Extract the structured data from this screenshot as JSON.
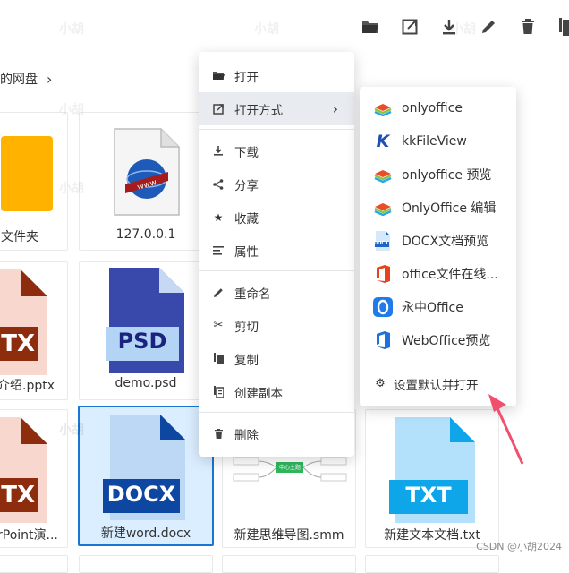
{
  "toolbar": {
    "icons": [
      "folder-open-icon",
      "open-external-icon",
      "download-icon",
      "edit-icon",
      "delete-icon",
      "copy-icon"
    ]
  },
  "breadcrumb": {
    "current": "的网盘",
    "separator": "›"
  },
  "files": [
    {
      "name": "文件夹",
      "type": "folder"
    },
    {
      "name": "127.0.0.1",
      "type": "web"
    },
    {
      "name": "介绍.pptx",
      "type": "pptx",
      "label_text": "TX"
    },
    {
      "name": "demo.psd",
      "type": "psd",
      "label_text": "PSD"
    },
    {
      "name": "rPoint演...",
      "type": "pptx",
      "label_text": "TX"
    },
    {
      "name": "新建word.docx",
      "type": "docx",
      "label_text": "DOCX"
    },
    {
      "name": "新建思维导图.smm",
      "type": "smm",
      "center_text": "中心主题"
    },
    {
      "name": "新建文本文档.txt",
      "type": "txt",
      "label_text": "TXT"
    }
  ],
  "context_menu": {
    "items": [
      {
        "label": "打开",
        "icon": "folder-open-icon"
      },
      {
        "label": "打开方式",
        "icon": "open-external-icon",
        "has_submenu": true
      },
      {
        "label": "下载",
        "icon": "download-icon"
      },
      {
        "label": "分享",
        "icon": "share-icon"
      },
      {
        "label": "收藏",
        "icon": "star-icon"
      },
      {
        "label": "属性",
        "icon": "properties-icon"
      },
      {
        "label": "重命名",
        "icon": "edit-icon"
      },
      {
        "label": "剪切",
        "icon": "scissors-icon"
      },
      {
        "label": "复制",
        "icon": "copy-icon"
      },
      {
        "label": "创建副本",
        "icon": "duplicate-icon"
      },
      {
        "label": "删除",
        "icon": "delete-icon"
      }
    ]
  },
  "submenu": {
    "items": [
      {
        "label": "onlyoffice",
        "icon": "onlyoffice-icon"
      },
      {
        "label": "kkFileView",
        "icon": "kkfileview-icon"
      },
      {
        "label": "onlyoffice 预览",
        "icon": "onlyoffice-icon"
      },
      {
        "label": "OnlyOffice 编辑",
        "icon": "onlyoffice-icon"
      },
      {
        "label": "DOCX文档预览",
        "icon": "docx-icon",
        "icon_text": "DOCX"
      },
      {
        "label": "office文件在线...",
        "icon": "office-icon"
      },
      {
        "label": "永中Office",
        "icon": "yozo-office-icon"
      },
      {
        "label": "WebOffice预览",
        "icon": "weboffice-icon"
      }
    ],
    "footer": {
      "label": "设置默认并打开",
      "icon": "gear-icon"
    }
  },
  "watermark_text": "小胡",
  "footer_credit": "CSDN @小胡2024",
  "colors": {
    "accent": "#1976d2",
    "folder": "#ffb300",
    "pptx_bg": "#f8d7cf",
    "pptx_label": "#8e2d0e",
    "psd_bg": "#3949ab",
    "psd_label": "#b3d4f5",
    "docx_bg": "#bcd8f5",
    "docx_label": "#0d47a1",
    "txt_bg": "#b3e0fb",
    "txt_label": "#0ea5e9",
    "arrow": "#f0506e"
  }
}
